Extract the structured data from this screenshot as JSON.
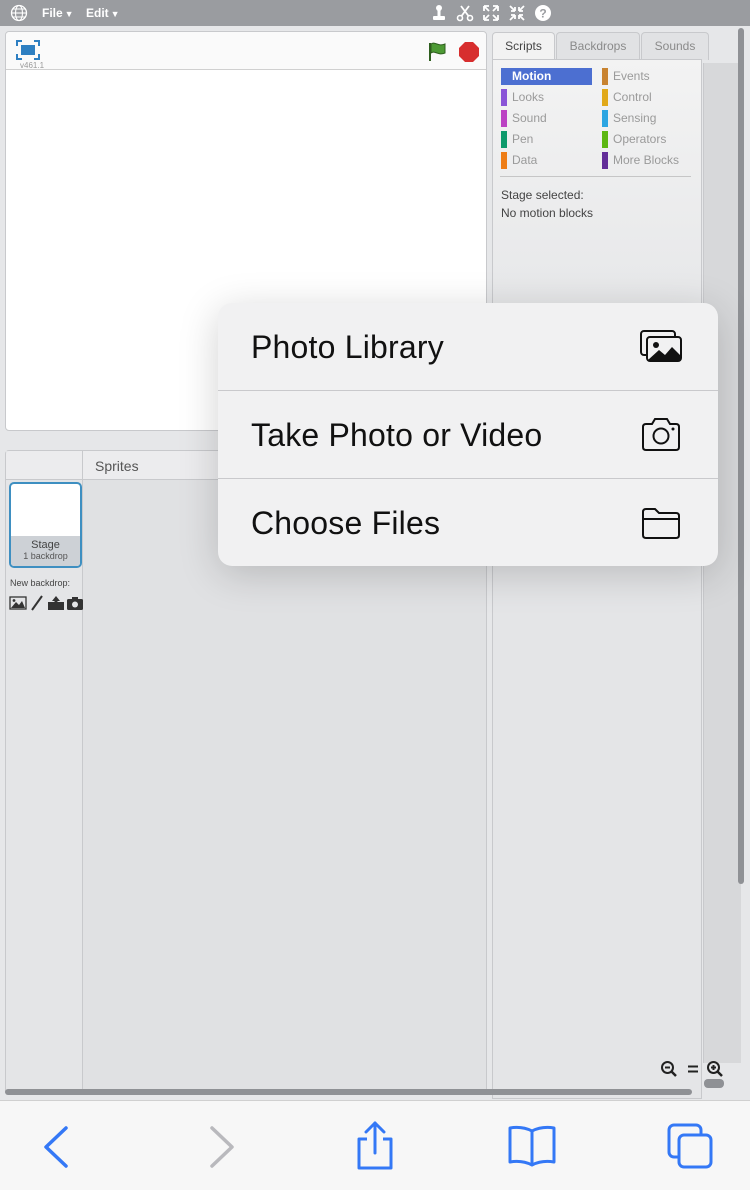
{
  "menubar": {
    "file_label": "File",
    "edit_label": "Edit"
  },
  "stage": {
    "version": "v461.1"
  },
  "sprites_pane": {
    "title": "Sprites",
    "stage_thumb_label": "Stage",
    "stage_thumb_count": "1 backdrop",
    "new_backdrop_label": "New backdrop:"
  },
  "tabs": [
    "Scripts",
    "Backdrops",
    "Sounds"
  ],
  "categories": [
    {
      "label": "Motion",
      "color": "#4a6cd4"
    },
    {
      "label": "Looks",
      "color": "#8a55d7"
    },
    {
      "label": "Sound",
      "color": "#bb42c3"
    },
    {
      "label": "Pen",
      "color": "#0e9a6c"
    },
    {
      "label": "Data",
      "color": "#ee7d16"
    },
    {
      "label": "Events",
      "color": "#c88330"
    },
    {
      "label": "Control",
      "color": "#e1a91a"
    },
    {
      "label": "Sensing",
      "color": "#2ca5e2"
    },
    {
      "label": "Operators",
      "color": "#5cb712"
    },
    {
      "label": "More Blocks",
      "color": "#632d99"
    }
  ],
  "palette_info": {
    "stage_selected": "Stage selected:",
    "no_motion": "No motion blocks"
  },
  "popup": {
    "items": [
      {
        "label": "Photo Library",
        "icon": "photo-library-icon"
      },
      {
        "label": "Take Photo or Video",
        "icon": "camera-icon"
      },
      {
        "label": "Choose Files",
        "icon": "folder-icon"
      }
    ]
  },
  "colors": {
    "accent": "#4c6fd1",
    "ios_blue": "#3478f6",
    "selected_border": "#3e8fc1"
  }
}
